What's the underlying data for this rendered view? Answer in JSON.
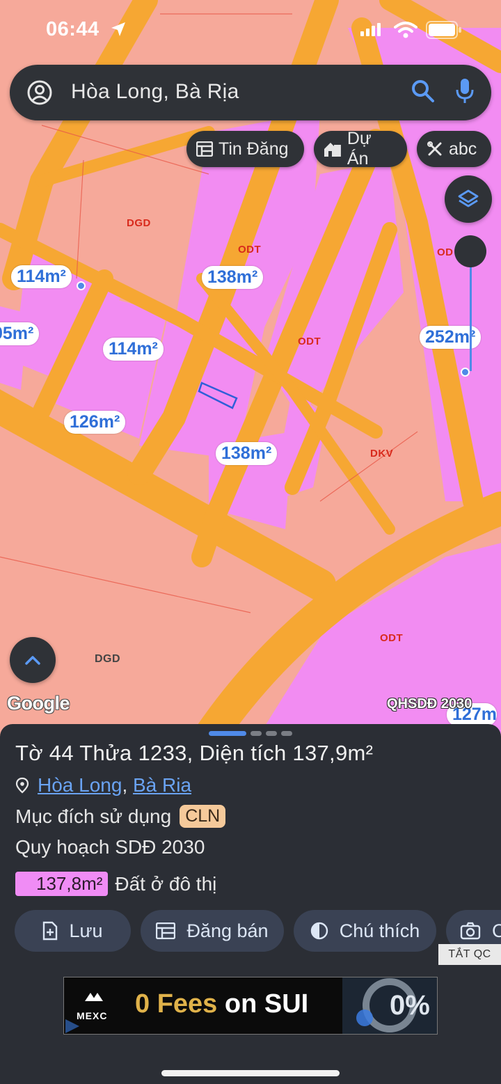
{
  "status_bar": {
    "time": "06:44"
  },
  "search": {
    "query": "Hòa Long, Bà Rịa"
  },
  "chips": [
    {
      "label": "Tin Đăng",
      "icon": "listing-icon"
    },
    {
      "label": "Dự Án",
      "icon": "building-icon"
    },
    {
      "label": "abc",
      "icon": "tools-icon"
    }
  ],
  "map": {
    "zone_labels": [
      "DGD",
      "ODT",
      "ODT",
      "ODT",
      "DKV",
      "ODT",
      "DGD",
      "OD"
    ],
    "area_labels": [
      "114m²",
      "138m²",
      "05m²",
      "114m²",
      "252m²",
      "126m²",
      "138m²",
      "127m"
    ],
    "branding": "Google",
    "layer_name": "QHSDĐ 2030"
  },
  "sheet": {
    "title": "Tờ 44 Thửa 1233, Diện tích 137,9m²",
    "ward": "Hòa Long",
    "separator": ",",
    "city": "Bà Ria",
    "usage_label": "Mục đích sử dụng",
    "usage_code": "CLN",
    "plan_label": "Quy hoạch SDĐ 2030",
    "plan_area": "137,8m²",
    "plan_type": "Đất ở đô thị",
    "actions": [
      {
        "label": "Lưu"
      },
      {
        "label": "Đăng bán"
      },
      {
        "label": "Chú thích"
      },
      {
        "label": "C"
      }
    ],
    "ad_close_label": "TẮT QC"
  },
  "ad": {
    "brand": "MEXC",
    "text_highlight": "0 Fees",
    "text_rest": " on SUI",
    "badge": "0%"
  },
  "colors": {
    "map_background": "#f6a99a",
    "road": "#f6a733",
    "residential": "#f28cf2",
    "accent": "#4f8ae8",
    "sheet_background": "#2b2e35"
  }
}
